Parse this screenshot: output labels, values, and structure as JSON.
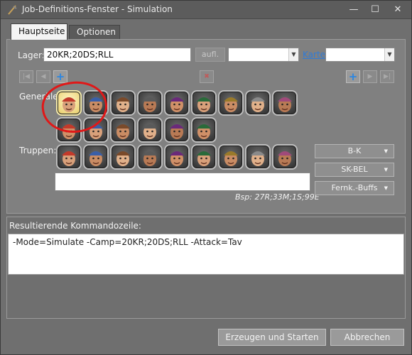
{
  "window": {
    "title": "Job-Definitions-Fenster - Simulation",
    "controls": {
      "minimize": "—",
      "maximize": "☐",
      "close": "✕"
    }
  },
  "tabs": [
    {
      "label": "Hauptseite",
      "active": true
    },
    {
      "label": "Optionen",
      "active": false
    }
  ],
  "camp": {
    "label": "Lager:",
    "value": "20KR;20DS;RLL",
    "apply_label": "aufl.",
    "combo1_value": "",
    "map_link": "Karte",
    "combo2_value": ""
  },
  "generals": {
    "label": "Generäle:",
    "icons": [
      "general-1-icon",
      "general-2-icon",
      "general-3-icon",
      "general-4-icon",
      "general-5-icon",
      "general-6-icon",
      "general-7-icon",
      "general-8-icon",
      "general-9-icon",
      "general-10-icon",
      "general-11-icon",
      "general-12-icon",
      "general-13-icon",
      "general-14-icon",
      "general-15-icon"
    ],
    "selected_index": 0
  },
  "troops": {
    "label": "Truppen:",
    "icons": [
      "recruit-icon",
      "bowman-icon",
      "militia-icon",
      "cavalry-icon",
      "longbowman-icon",
      "soldier-icon",
      "crossbowman-icon",
      "elite-soldier-icon",
      "cannoneer-icon"
    ],
    "input_value": "",
    "example": "Bsp: 27R;33M;1S;99E"
  },
  "side_buttons": {
    "bk": "B-K",
    "skbel": "SK-BEL",
    "ranged": "Fernk.-Buffs"
  },
  "result": {
    "label": "Resultierende Kommandozeile:",
    "command": "-Mode=Simulate -Camp=20KR;20DS;RLL -Attack=Tav"
  },
  "footer": {
    "start": "Erzeugen und Starten",
    "cancel": "Abbrechen"
  },
  "colors": {
    "accent_blue": "#2a86e2",
    "annotation_red": "#e01818",
    "selected_gold": "#e7cc66"
  }
}
